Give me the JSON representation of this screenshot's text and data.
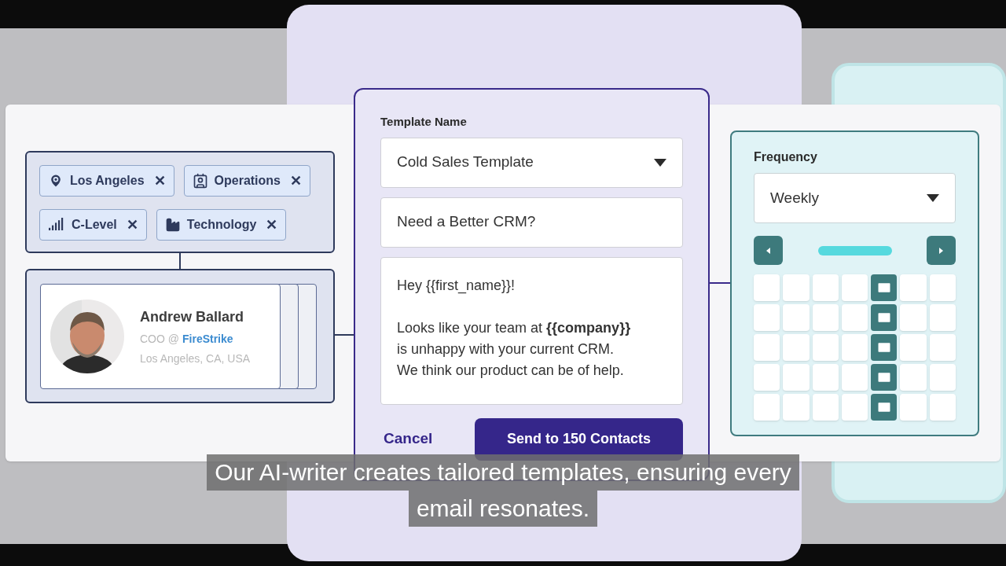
{
  "filters": {
    "tags": [
      {
        "kind": "location",
        "label": "Los Angeles",
        "remove": "✕"
      },
      {
        "kind": "department",
        "label": "Operations",
        "remove": "✕"
      },
      {
        "kind": "seniority",
        "label": "C-Level",
        "remove": "✕"
      },
      {
        "kind": "industry",
        "label": "Technology",
        "remove": "✕"
      }
    ]
  },
  "contact": {
    "name": "Andrew Ballard",
    "role": "COO @",
    "company": "FireStrike",
    "location": "Los Angeles, CA, USA"
  },
  "template": {
    "label": "Template Name",
    "name": "Cold Sales Template",
    "subject": "Need a Better CRM?",
    "body": [
      "Hey {{first_name}}!",
      "Looks like your team at **{{company}}**",
      "is unhappy with your current CRM.",
      "We think our product can be of help."
    ],
    "cancel": "Cancel",
    "send": "Send to 150 Contacts"
  },
  "schedule": {
    "label": "Frequency",
    "frequency": "Weekly",
    "weeks": [
      [
        {
          "scheduled": false
        },
        {
          "scheduled": false
        },
        {
          "scheduled": false
        },
        {
          "scheduled": false
        },
        {
          "scheduled": true
        },
        {
          "scheduled": false
        },
        {
          "scheduled": false
        }
      ],
      [
        {
          "scheduled": false
        },
        {
          "scheduled": false
        },
        {
          "scheduled": false
        },
        {
          "scheduled": false
        },
        {
          "scheduled": true
        },
        {
          "scheduled": false
        },
        {
          "scheduled": false
        }
      ],
      [
        {
          "scheduled": false
        },
        {
          "scheduled": false
        },
        {
          "scheduled": false
        },
        {
          "scheduled": false
        },
        {
          "scheduled": true
        },
        {
          "scheduled": false
        },
        {
          "scheduled": false
        }
      ],
      [
        {
          "scheduled": false
        },
        {
          "scheduled": false
        },
        {
          "scheduled": false
        },
        {
          "scheduled": false
        },
        {
          "scheduled": true
        },
        {
          "scheduled": false
        },
        {
          "scheduled": false
        }
      ],
      [
        {
          "scheduled": false
        },
        {
          "scheduled": false
        },
        {
          "scheduled": false
        },
        {
          "scheduled": false
        },
        {
          "scheduled": true
        },
        {
          "scheduled": false
        },
        {
          "scheduled": false
        }
      ]
    ]
  },
  "subtitle": [
    "Our AI-writer creates tailored templates, ensuring every",
    "email resonates."
  ]
}
